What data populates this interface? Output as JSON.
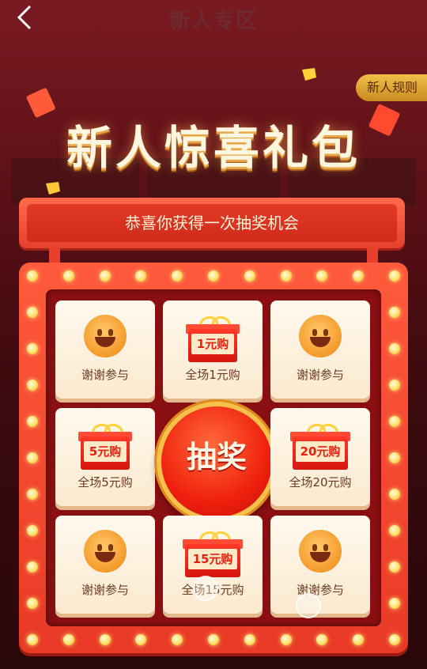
{
  "header": {
    "title": "新人专区",
    "rules_label": "新人规则"
  },
  "hero": {
    "title": "新人惊喜礼包"
  },
  "banner": {
    "text": "恭喜你获得一次抽奖机会"
  },
  "draw_button": {
    "label": "抽奖"
  },
  "prizes": [
    {
      "type": "smiley",
      "label": "谢谢参与"
    },
    {
      "type": "gift",
      "tag": "1元购",
      "label": "全场1元购"
    },
    {
      "type": "smiley",
      "label": "谢谢参与"
    },
    {
      "type": "gift",
      "tag": "5元购",
      "label": "全场5元购"
    },
    {
      "type": "gift",
      "tag": "20元购",
      "label": "全场20元购"
    },
    {
      "type": "smiley",
      "label": "谢谢参与"
    },
    {
      "type": "gift",
      "tag": "15元购",
      "label": "全场15元购"
    },
    {
      "type": "smiley",
      "label": "谢谢参与"
    }
  ],
  "colors": {
    "board_red": "#e83a26",
    "bulb_yellow": "#ffe066",
    "gold": "#f6c04a"
  },
  "icons": {
    "back": "chevron-left-icon",
    "smiley": "smiley-icon",
    "gift": "gift-box-icon"
  }
}
